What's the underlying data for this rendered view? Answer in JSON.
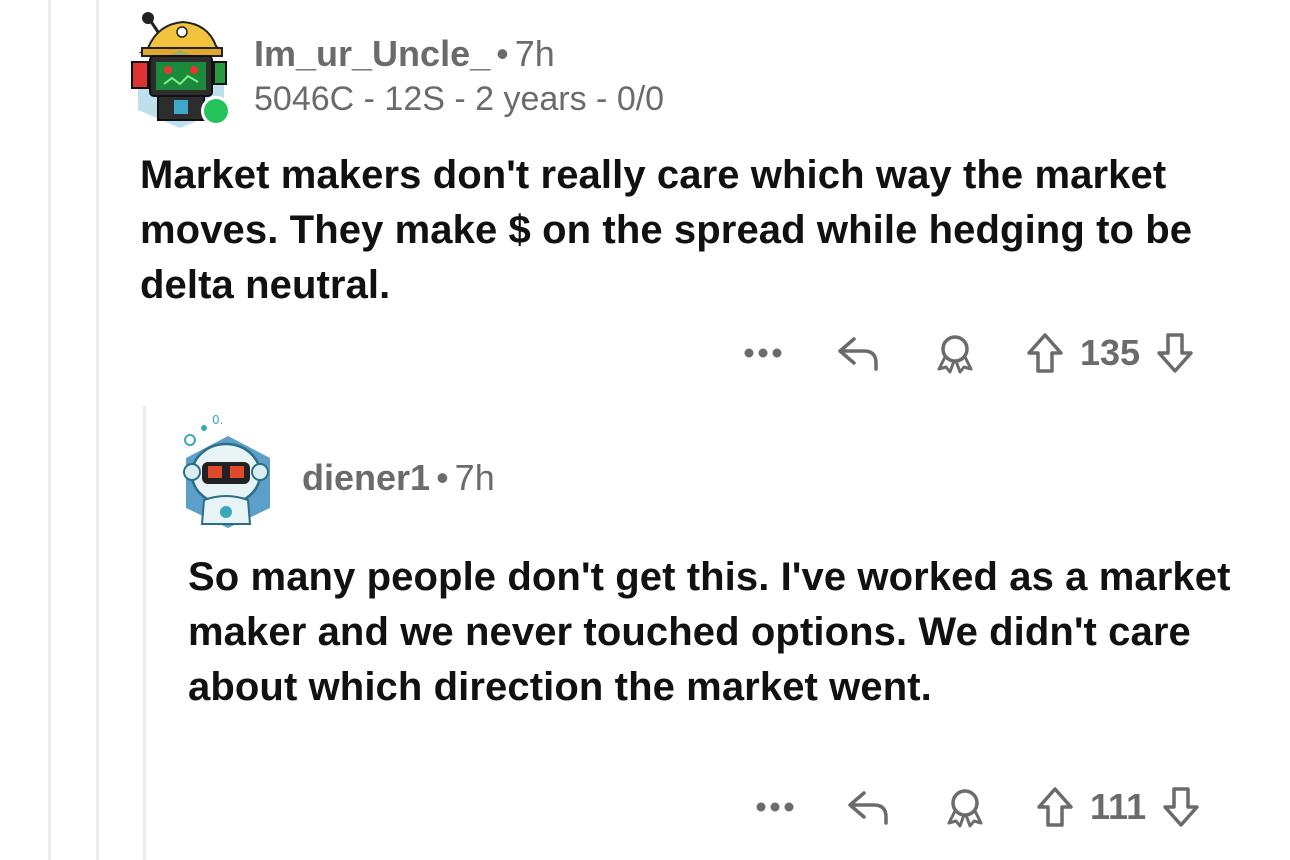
{
  "comments": [
    {
      "author": "Im_ur_Uncle_",
      "time": "7h",
      "flair": "5046C - 12S - 2 years - 0/0",
      "online": true,
      "body": "Market makers don't really care which way the market moves. They make $ on the spread while hedging to be delta neutral.",
      "score": "135",
      "actions": [
        "more-icon",
        "reply-icon",
        "award-icon",
        "upvote-icon",
        "downvote-icon"
      ]
    },
    {
      "author": "diener1",
      "time": "7h",
      "body": "So many people don't get this. I've worked as a market maker and we never touched options. We didn't care about which direction the market went.",
      "score": "111",
      "actions": [
        "more-icon",
        "reply-icon",
        "award-icon",
        "upvote-icon",
        "downvote-icon"
      ]
    }
  ],
  "colors": {
    "online_dot": "#24c35a",
    "meta_gray": "#6b6b6b",
    "thread_line": "#ececec"
  }
}
